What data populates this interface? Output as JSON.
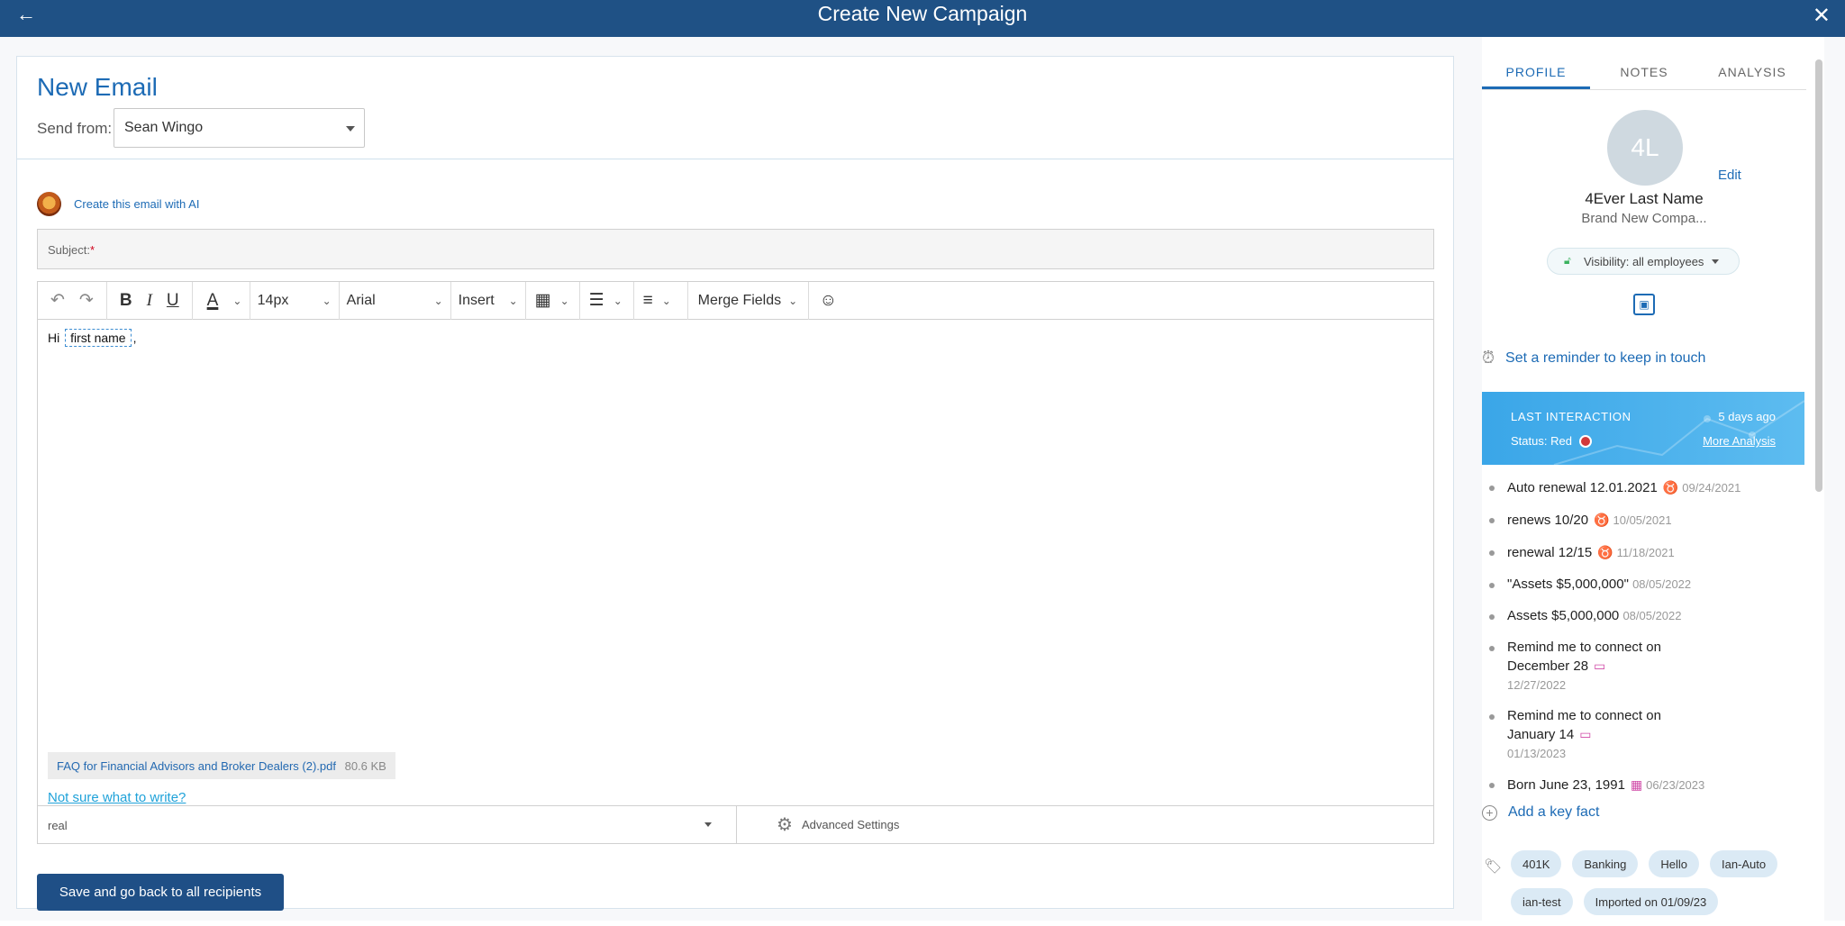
{
  "header": {
    "title": "Create New Campaign",
    "back_icon": "←",
    "close_icon": "✕"
  },
  "editor_panel": {
    "title": "New Email",
    "send_from_label": "Send from:",
    "send_from_value": "Sean Wingo",
    "ai_link": "Create this email with AI",
    "subject_label": "Subject:",
    "subject_required": "*",
    "toolbar": {
      "undo_icon": "↶",
      "redo_icon": "↷",
      "bold": "B",
      "italic": "I",
      "underline": "U",
      "font_color_icon": "A",
      "font_size": "14px",
      "font_family": "Arial",
      "insert": "Insert",
      "table_icon": "▦",
      "list_icon": "☰",
      "align_icon": "≡",
      "merge_fields": "Merge Fields",
      "emoji_icon": "☺"
    },
    "body_greeting": "Hi",
    "body_merge_field": "first name",
    "body_trailing": ",",
    "attachment_name": "FAQ for Financial Advisors and Broker Dealers (2).pdf",
    "attachment_size": "80.6 KB",
    "help_link": "Not sure what to write?",
    "footer_select_value": "real",
    "advanced_settings": "Advanced Settings",
    "save_button": "Save and go back to all recipients"
  },
  "profile_panel": {
    "tabs": [
      "PROFILE",
      "NOTES",
      "ANALYSIS"
    ],
    "avatar_initials": "4L",
    "edit_link": "Edit",
    "name": "4Ever Last Name",
    "company": "Brand New Compa...",
    "visibility": "Visibility: all employees",
    "reminder": "Set a reminder to keep in touch",
    "interaction": {
      "label": "LAST INTERACTION",
      "ago": "5 days ago",
      "status_label": "Status: Red",
      "status_color": "#d2383b",
      "more_link": "More Analysis"
    },
    "facts": [
      {
        "text": "Auto renewal 12.01.2021",
        "icon": "♉",
        "date": "09/24/2021"
      },
      {
        "text": "renews 10/20",
        "icon": "♉",
        "date": "10/05/2021"
      },
      {
        "text": "renewal 12/15",
        "icon": "♉",
        "date": "11/18/2021"
      },
      {
        "text": "\"Assets $5,000,000\"",
        "icon": "",
        "date": "08/05/2022"
      },
      {
        "text": "Assets $5,000,000",
        "icon": "",
        "date": "08/05/2022"
      },
      {
        "text": "Remind me to connect on December 28",
        "icon": "▭",
        "date": "12/27/2022"
      },
      {
        "text": "Remind me to connect on January 14",
        "icon": "▭",
        "date": "01/13/2023"
      },
      {
        "text": "Born June 23, 1991",
        "icon": "▦",
        "date": "06/23/2023"
      }
    ],
    "add_fact": "Add a key fact",
    "tags": [
      "401K",
      "Banking",
      "Hello",
      "Ian-Auto",
      "ian-test",
      "Imported on 01/09/23"
    ]
  },
  "colors": {
    "header_bg": "#1f5185",
    "accent": "#1d6bb5",
    "primary_button": "#1f4f86"
  }
}
